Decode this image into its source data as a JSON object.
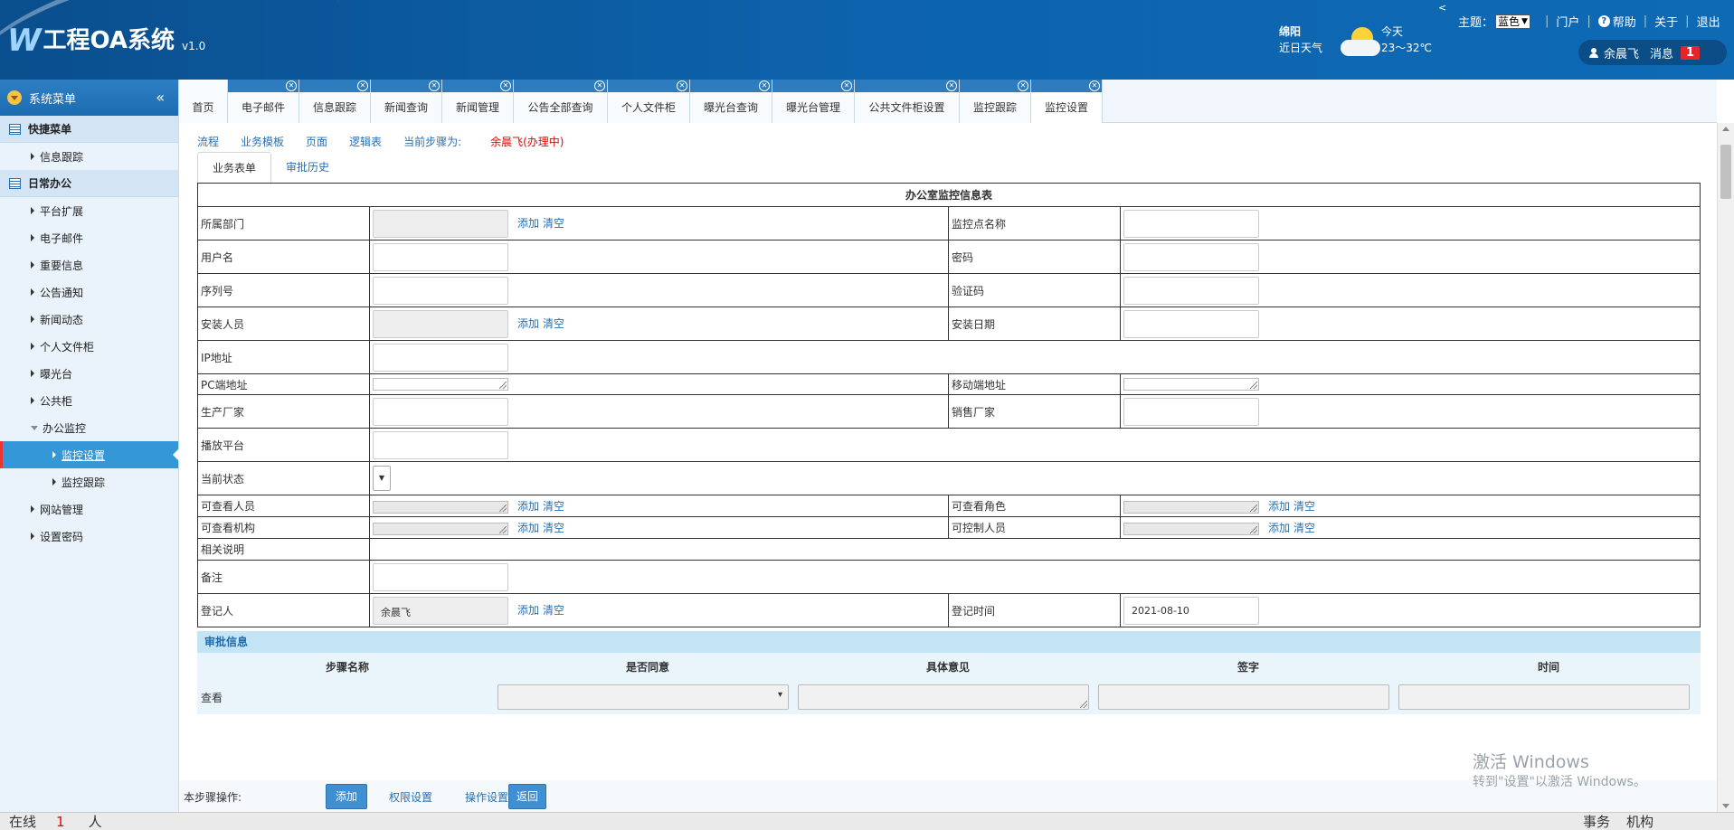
{
  "header": {
    "logo_mark": "W",
    "title": "工程OA系统",
    "version": "v1.0",
    "weather_city": "绵阳",
    "weather_label": "近日天气",
    "today_label": "今天",
    "today_temp": "23～32℃",
    "theme_label": "主题：",
    "theme_value": "蓝色",
    "nav_portal": "门户",
    "nav_help": "帮助",
    "nav_about": "关于",
    "nav_logout": "退出",
    "user_name": "余晨飞",
    "msg_label": "消息",
    "msg_count": "1",
    "corner_mark": "<"
  },
  "sidebar": {
    "title": "系统菜单",
    "sec_quick": "快捷菜单",
    "quick_item": "信息跟踪",
    "sec_daily": "日常办公",
    "items": [
      "平台扩展",
      "电子邮件",
      "重要信息",
      "公告通知",
      "新闻动态",
      "个人文件柜",
      "曝光台",
      "公共柜",
      "办公监控"
    ],
    "sub_active": "监控设置",
    "sub_other": "监控跟踪",
    "items_after": [
      "网站管理",
      "设置密码"
    ]
  },
  "tabs": [
    "首页",
    "电子邮件",
    "信息跟踪",
    "新闻查询",
    "新闻管理",
    "公告全部查询",
    "个人文件柜",
    "曝光台查询",
    "曝光台管理",
    "公共文件柜设置",
    "监控跟踪",
    "监控设置"
  ],
  "steplinks": {
    "flow": "流程",
    "tpl": "业务模板",
    "page": "页面",
    "logic": "逻辑表",
    "step": "当前步骤为:",
    "cur": "余晨飞(办理中)"
  },
  "formtabs": [
    "业务表单",
    "审批历史"
  ],
  "form": {
    "caption": "办公室监控信息表",
    "add": "添加",
    "clear": "清空",
    "dept": "所属部门",
    "point": "监控点名称",
    "user": "用户名",
    "pwd": "密码",
    "serial": "序列号",
    "code": "验证码",
    "installer": "安装人员",
    "install_date": "安装日期",
    "ip": "IP地址",
    "pc": "PC端地址",
    "mobile": "移动端地址",
    "maker": "生产厂家",
    "seller": "销售厂家",
    "platform": "播放平台",
    "state": "当前状态",
    "viewers": "可查看人员",
    "roles": "可查看角色",
    "orgs": "可查看机构",
    "controllers": "可控制人员",
    "desc": "相关说明",
    "remark": "备注",
    "reg_user": "登记人",
    "reg_user_val": "余晨飞",
    "reg_time": "登记时间",
    "reg_time_val": "2021-08-10"
  },
  "approval": {
    "title": "审批信息",
    "cols": [
      "步骤名称",
      "是否同意",
      "具体意见",
      "签字",
      "时间"
    ],
    "row_step": "查看"
  },
  "ops": {
    "label": "本步骤操作:",
    "add": "添加",
    "perm": "权限设置",
    "opset": "操作设置",
    "back": "返回"
  },
  "watermark": {
    "line1": "激活 Windows",
    "line2": "转到\"设置\"以激活 Windows。"
  },
  "status": {
    "online": "在线",
    "count": "1",
    "unit": "人",
    "affairs": "事务",
    "org": "机构"
  }
}
